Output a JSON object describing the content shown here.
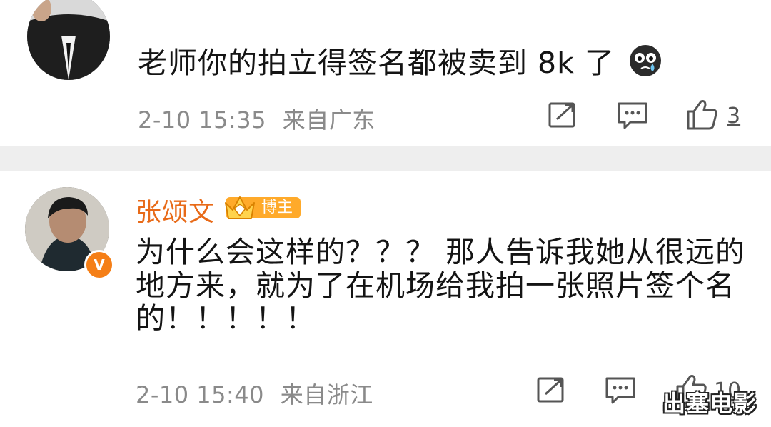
{
  "comments": [
    {
      "text": "老师你的拍立得签名都被卖到 8k 了",
      "emoji_icon": "crying-face-icon",
      "time": "2-10 15:35",
      "location": "来自广东",
      "likes": "3"
    },
    {
      "username": "张颂文",
      "badge": "博主",
      "verified_mark": "V",
      "text": "为什么会这样的？？？ 那人告诉我她从很远的地方来，就为了在机场给我拍一张照片签个名的！！！！！",
      "time": "2-10 15:40",
      "location": "来自浙江",
      "likes": "10"
    }
  ],
  "watermark": "出塞电影",
  "colors": {
    "username": "#e86a18",
    "badge": "#ffaa2a",
    "separator": "#eeeeee",
    "meta": "#8a8a8a"
  }
}
